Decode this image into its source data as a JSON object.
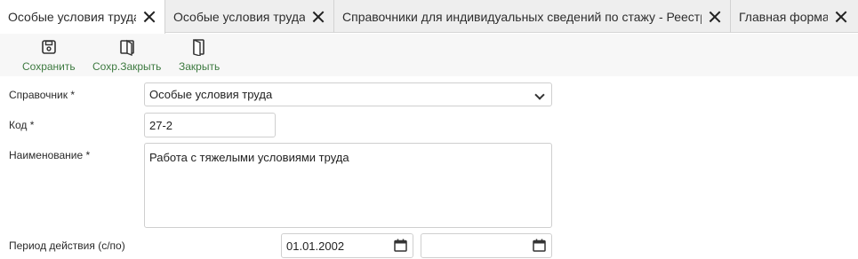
{
  "tabs": [
    {
      "label": "Особые условия труда",
      "active": true
    },
    {
      "label": "Особые условия труда",
      "active": false
    },
    {
      "label": "Справочники для индивидуальных сведений по стажу - Реестр",
      "active": false
    },
    {
      "label": "Главная форма",
      "active": false
    }
  ],
  "toolbar": {
    "save_label": "Сохранить",
    "save_close_label": "Сохр.Закрыть",
    "close_label": "Закрыть",
    "icon_color": "#3d7a40"
  },
  "form": {
    "directory": {
      "label": "Справочник *",
      "value": "Особые условия труда"
    },
    "code": {
      "label": "Код *",
      "value": "27-2"
    },
    "name": {
      "label": "Наименование *",
      "value": "Работа с тяжелыми условиями труда"
    },
    "period": {
      "label": "Период действия (с/по)",
      "from": "01.01.2002",
      "to": ""
    }
  }
}
